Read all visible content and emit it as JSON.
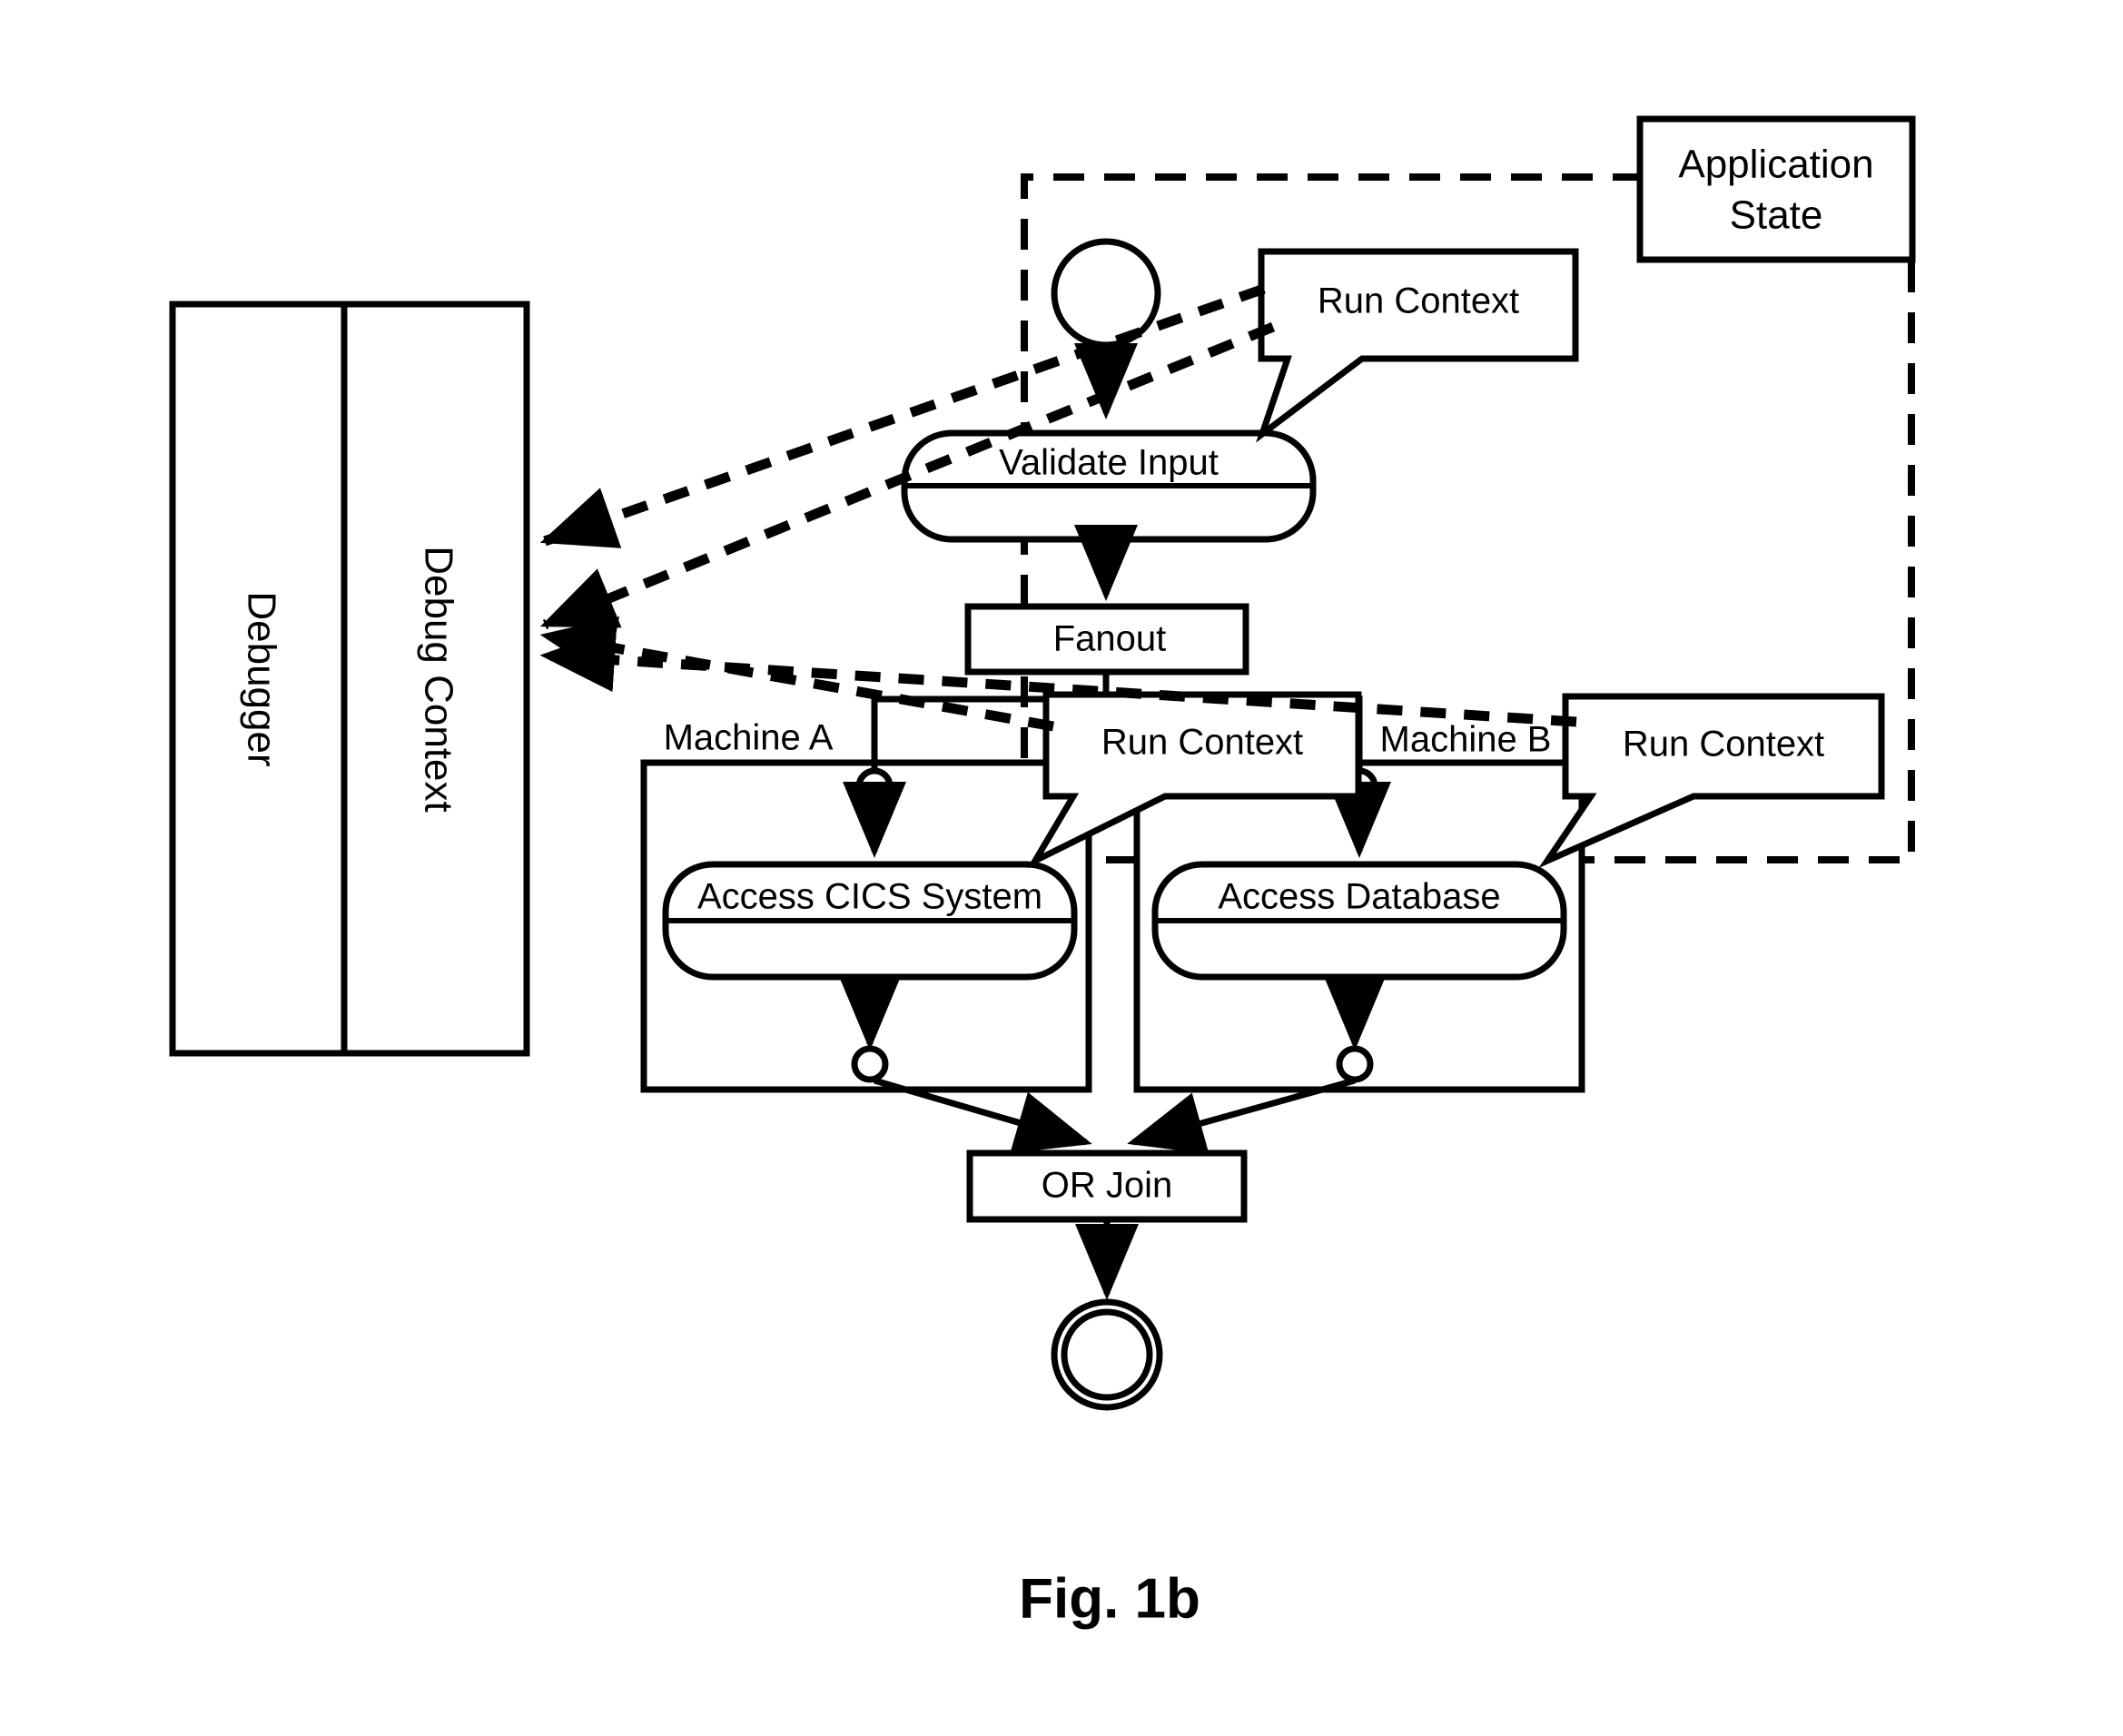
{
  "figure": {
    "caption": "Fig. 1b"
  },
  "debugger_panel": {
    "outer_label": "Debugger",
    "inner_label": "Debug Context"
  },
  "application_state": {
    "label": "Application State",
    "line1": "Application",
    "line2": "State"
  },
  "callouts": [
    {
      "id": "run-context-top",
      "label": "Run Context"
    },
    {
      "id": "run-context-middle",
      "label": "Run Context"
    },
    {
      "id": "run-context-right",
      "label": "Run Context"
    }
  ],
  "swimlanes": [
    {
      "id": "machine-a",
      "label": "Machine A"
    },
    {
      "id": "machine-b",
      "label": "Machine B"
    }
  ],
  "activities": [
    {
      "id": "validate-input",
      "label": "Validate Input"
    },
    {
      "id": "access-cics-system",
      "label": "Access CICS System"
    },
    {
      "id": "access-database",
      "label": "Access Database"
    }
  ],
  "control_nodes": [
    {
      "id": "fanout",
      "label": "Fanout"
    },
    {
      "id": "or-join",
      "label": "OR Join"
    }
  ],
  "markers": {
    "start_node": "start-circle",
    "end_node": "end-double-circle",
    "pin_a": "connector-pin",
    "pin_b": "connector-pin"
  },
  "colors": {
    "stroke": "#000000",
    "fill": "#ffffff",
    "background": "#ffffff"
  }
}
